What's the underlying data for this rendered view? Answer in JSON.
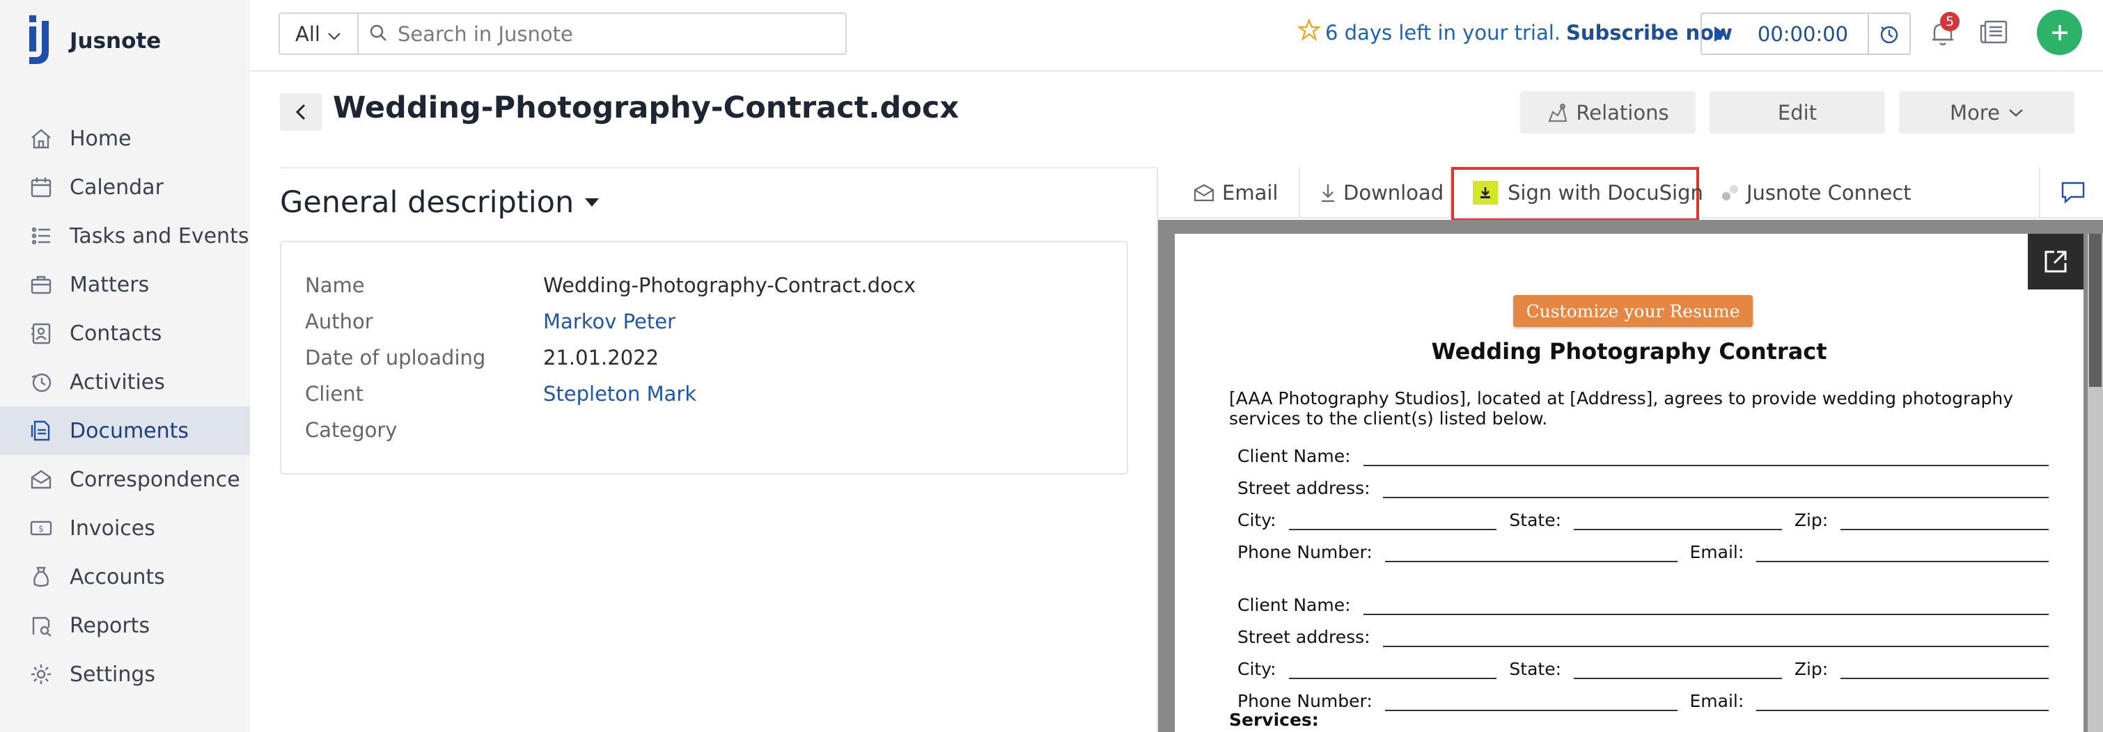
{
  "app": {
    "name": "Jusnote"
  },
  "sidebar": {
    "items": [
      {
        "label": "Home",
        "icon": "home-icon",
        "active": false
      },
      {
        "label": "Calendar",
        "icon": "calendar-icon",
        "active": false
      },
      {
        "label": "Tasks and Events",
        "icon": "tasks-icon",
        "active": false
      },
      {
        "label": "Matters",
        "icon": "briefcase-icon",
        "active": false
      },
      {
        "label": "Contacts",
        "icon": "contacts-icon",
        "active": false
      },
      {
        "label": "Activities",
        "icon": "activities-icon",
        "active": false
      },
      {
        "label": "Documents",
        "icon": "documents-icon",
        "active": true
      },
      {
        "label": "Correspondence",
        "icon": "correspondence-icon",
        "active": false
      },
      {
        "label": "Invoices",
        "icon": "invoice-icon",
        "active": false
      },
      {
        "label": "Accounts",
        "icon": "accounts-icon",
        "active": false
      },
      {
        "label": "Reports",
        "icon": "reports-icon",
        "active": false
      },
      {
        "label": "Settings",
        "icon": "settings-icon",
        "active": false
      }
    ]
  },
  "topbar": {
    "search_scope": "All",
    "search_placeholder": "Search in Jusnote",
    "trial_text": "6 days left in your trial.",
    "subscribe_label": "Subscribe now",
    "timer_value": "00:00:00",
    "notification_count": "5"
  },
  "document": {
    "title": "Wedding-Photography-Contract.docx",
    "buttons": {
      "relations": "Relations",
      "edit": "Edit",
      "more": "More"
    }
  },
  "general_description": {
    "heading": "General description",
    "fields": [
      {
        "label": "Name",
        "value": "Wedding-Photography-Contract.docx",
        "link": false
      },
      {
        "label": "Author",
        "value": "Markov Peter",
        "link": true
      },
      {
        "label": "Date of uploading",
        "value": "21.01.2022",
        "link": false
      },
      {
        "label": "Client",
        "value": "Stepleton Mark",
        "link": true
      },
      {
        "label": "Category",
        "value": "",
        "link": false
      }
    ]
  },
  "viewer": {
    "tabs": {
      "email": "Email",
      "download": "Download",
      "docusign": "Sign with DocuSign",
      "connect": "Jusnote Connect"
    },
    "paper": {
      "customize_label": "Customize your Resume",
      "title": "Wedding Photography Contract",
      "intro": "[AAA Photography Studios], located at [Address], agrees to provide wedding photography services to the client(s) listed below.",
      "labels": {
        "client_name": "Client Name:",
        "street": "Street address:",
        "city": "City:",
        "state": "State:",
        "zip": "Zip:",
        "phone": "Phone Number:",
        "email": "Email:"
      },
      "services": "Services:"
    }
  },
  "colors": {
    "accent": "#1f56a8",
    "active_nav": "#dfe4ec",
    "add_button": "#2db26a",
    "highlight": "#e0332b",
    "badge": "#d2383a"
  }
}
